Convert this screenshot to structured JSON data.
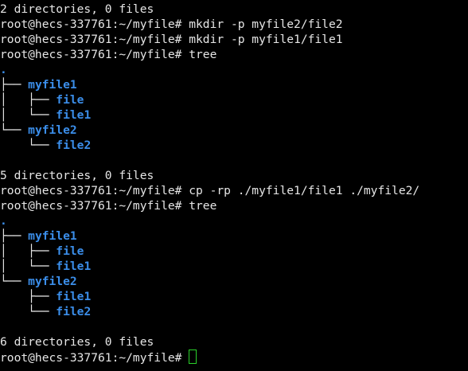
{
  "terminal": {
    "lines": [
      {
        "type": "text",
        "text": "2 directories, 0 files"
      },
      {
        "type": "cmd",
        "prompt": "root@hecs-337761:~/myfile# ",
        "command": "mkdir -p myfile2/file2"
      },
      {
        "type": "cmd",
        "prompt": "root@hecs-337761:~/myfile# ",
        "command": "mkdir -p myfile1/file1"
      },
      {
        "type": "cmd",
        "prompt": "root@hecs-337761:~/myfile# ",
        "command": "tree"
      },
      {
        "type": "root",
        "text": "."
      },
      {
        "type": "tree",
        "branch": "├── ",
        "name": "myfile1"
      },
      {
        "type": "tree",
        "branch": "│   ├── ",
        "name": "file"
      },
      {
        "type": "tree",
        "branch": "│   └── ",
        "name": "file1"
      },
      {
        "type": "tree",
        "branch": "└── ",
        "name": "myfile2"
      },
      {
        "type": "tree",
        "branch": "    └── ",
        "name": "file2"
      },
      {
        "type": "blank",
        "text": ""
      },
      {
        "type": "text",
        "text": "5 directories, 0 files"
      },
      {
        "type": "cmd",
        "prompt": "root@hecs-337761:~/myfile# ",
        "command": "cp -rp ./myfile1/file1 ./myfile2/"
      },
      {
        "type": "cmd",
        "prompt": "root@hecs-337761:~/myfile# ",
        "command": "tree"
      },
      {
        "type": "root",
        "text": "."
      },
      {
        "type": "tree",
        "branch": "├── ",
        "name": "myfile1"
      },
      {
        "type": "tree",
        "branch": "│   ├── ",
        "name": "file"
      },
      {
        "type": "tree",
        "branch": "│   └── ",
        "name": "file1"
      },
      {
        "type": "tree",
        "branch": "└── ",
        "name": "myfile2"
      },
      {
        "type": "tree",
        "branch": "    ├── ",
        "name": "file1"
      },
      {
        "type": "tree",
        "branch": "    └── ",
        "name": "file2"
      },
      {
        "type": "blank",
        "text": ""
      },
      {
        "type": "text",
        "text": "6 directories, 0 files"
      },
      {
        "type": "prompt",
        "prompt": "root@hecs-337761:~/myfile# ",
        "command": ""
      }
    ],
    "colors": {
      "background": "#000000",
      "foreground": "#e6e6e6",
      "directory": "#3b8eea",
      "cursor": "#2bd12b"
    }
  }
}
